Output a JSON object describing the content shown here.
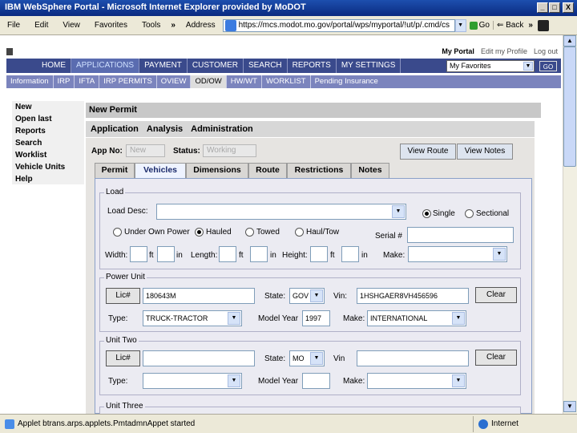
{
  "window": {
    "title": "IBM WebSphere Portal - Microsoft Internet Explorer provided by MoDOT",
    "min": "_",
    "max": "□",
    "close": "X"
  },
  "menubar": {
    "items": [
      "File",
      "Edit",
      "View",
      "Favorites",
      "Tools"
    ],
    "more": "»",
    "address_label": "Address",
    "address_value": "https://mcs.modot.mo.gov/portal/wps/myportal/!ut/p/.cmd/cs",
    "go_label": "Go",
    "back_label": "Back",
    "more2": "»"
  },
  "portal": {
    "links": [
      "My Portal",
      "Edit my Profile",
      "Log out"
    ],
    "favorites_value": "My Favorites",
    "go_button": "GO"
  },
  "nav1": {
    "items": [
      "HOME",
      "APPLICATIONS",
      "PAYMENT",
      "CUSTOMER",
      "SEARCH",
      "REPORTS",
      "MY SETTINGS"
    ],
    "active": 1
  },
  "nav2": {
    "items": [
      "Information",
      "IRP",
      "IFTA",
      "IRP PERMITS",
      "OVIEW",
      "OD/OW",
      "HW/WT",
      "WORKLIST",
      "Pending Insurance"
    ],
    "active": 5
  },
  "sidebar": {
    "items": [
      "New",
      "Open last",
      "Reports",
      "Search",
      "Worklist",
      "Vehicle Units",
      "Help"
    ]
  },
  "panel": {
    "title": "New Permit",
    "menu": [
      "Application",
      "Analysis",
      "Administration"
    ]
  },
  "app": {
    "app_no_label": "App No:",
    "app_no_value": "New",
    "status_label": "Status:",
    "status_value": "Working",
    "view_route": "View Route",
    "view_notes": "View Notes"
  },
  "tabs": [
    "Permit",
    "Vehicles",
    "Dimensions",
    "Route",
    "Restrictions",
    "Notes"
  ],
  "active_tab": 1,
  "load": {
    "legend": "Load",
    "desc_label": "Load Desc:",
    "single_label": "Single",
    "sectional_label": "Sectional",
    "single_selected": true,
    "options": [
      "Under Own Power",
      "Hauled",
      "Towed",
      "Haul/Tow"
    ],
    "selected_option": 1,
    "serial_label": "Serial #",
    "width_label": "Width:",
    "length_label": "Length:",
    "height_label": "Height:",
    "ft": "ft",
    "in": "in",
    "make_label": "Make:"
  },
  "power_unit": {
    "legend": "Power Unit",
    "lic_button": "Lic#",
    "lic_value": "180643M",
    "state_label": "State:",
    "state_value": "GOV",
    "vin_label": "Vin:",
    "vin_value": "1HSHGAER8VH456596",
    "clear_button": "Clear",
    "type_label": "Type:",
    "type_value": "TRUCK-TRACTOR",
    "model_year_label": "Model Year",
    "model_year_value": "1997",
    "make_label": "Make:",
    "make_value": "INTERNATIONAL"
  },
  "unit_two": {
    "legend": "Unit Two",
    "lic_button": "Lic#",
    "lic_value": "",
    "state_label": "State:",
    "state_value": "MO",
    "vin_label": "Vin",
    "vin_value": "",
    "clear_button": "Clear",
    "type_label": "Type:",
    "type_value": "",
    "model_year_label": "Model Year",
    "model_year_value": "",
    "make_label": "Make:",
    "make_value": ""
  },
  "unit_three": {
    "legend": "Unit Three"
  },
  "statusbar": {
    "text": "Applet btrans.arps.applets.PmtadmnAppet started",
    "zone": "Internet"
  }
}
